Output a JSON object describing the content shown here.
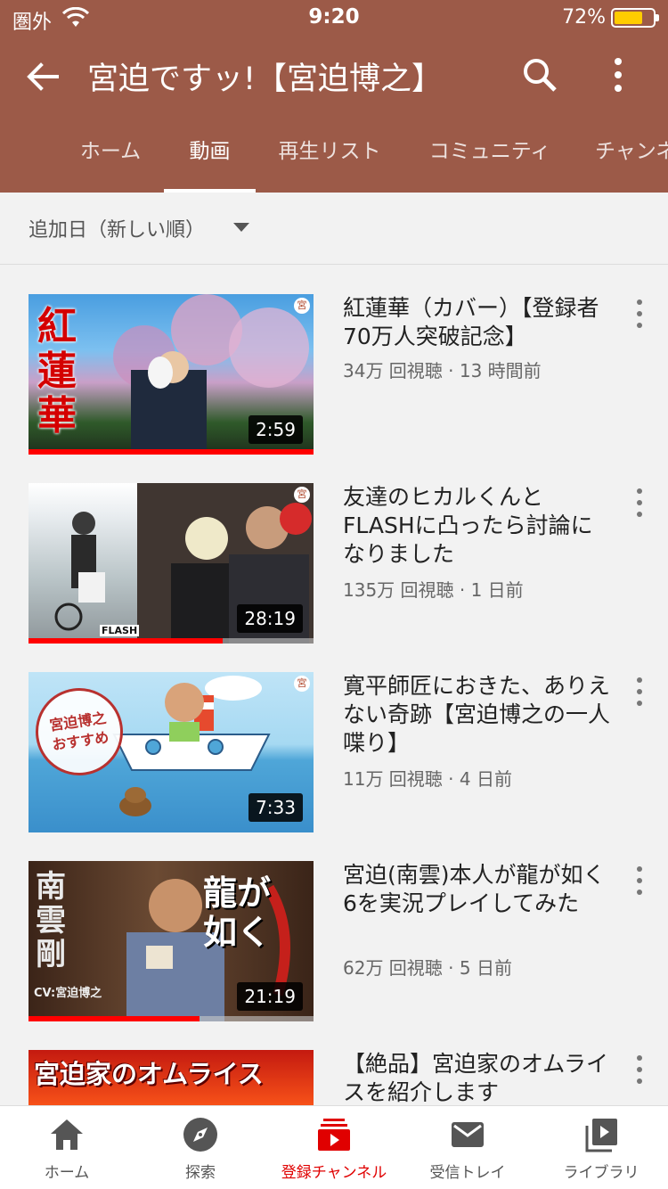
{
  "status_bar": {
    "carrier": "圏外",
    "time": "9:20",
    "battery": "72%"
  },
  "header": {
    "title": "宮迫ですッ!【宮迫博之】"
  },
  "tabs": [
    {
      "label": "ホーム"
    },
    {
      "label": "動画"
    },
    {
      "label": "再生リスト"
    },
    {
      "label": "コミュニティ"
    },
    {
      "label": "チャンネル"
    }
  ],
  "sort": {
    "label": "追加日（新しい順）"
  },
  "videos": [
    {
      "title": "紅蓮華（カバー）【登録者70万人突破記念】",
      "views": "34万 回視聴",
      "age": "13 時間前",
      "meta": "34万 回視聴 · 13 時間前",
      "duration": "2:59",
      "thumb_text": "紅蓮華",
      "progress": 1.0
    },
    {
      "title": "友達のヒカルくんとFLASHに凸ったら討論になりました",
      "views": "135万 回視聴",
      "age": "1 日前",
      "meta": "135万 回視聴 · 1 日前",
      "duration": "28:19",
      "thumb_text": "FLASH",
      "progress": 0.68
    },
    {
      "title": "寛平師匠におきた、ありえない奇跡【宮迫博之の一人喋り】",
      "views": "11万 回視聴",
      "age": "4 日前",
      "meta": "11万 回視聴 · 4 日前",
      "duration": "7:33",
      "thumb_text": "宮迫博之 おすすめ",
      "progress": 0
    },
    {
      "title": "宮迫(南雲)本人が龍が如く6を実況プレイしてみた",
      "views": "62万 回視聴",
      "age": "5 日前",
      "meta": "62万 回視聴 · 5 日前",
      "duration": "21:19",
      "thumb_text_left": "南雲剛",
      "thumb_text_right": "龍が如く",
      "thumb_caption": "CV:宮迫博之",
      "progress": 0.6
    },
    {
      "title": "【絶品】宮迫家のオムライスを紹介します",
      "thumb_text": "宮迫家のオムライス"
    }
  ],
  "bottom_nav": [
    {
      "label": "ホーム",
      "icon": "home-icon"
    },
    {
      "label": "探索",
      "icon": "explore-icon"
    },
    {
      "label": "登録チャンネル",
      "icon": "subscriptions-icon"
    },
    {
      "label": "受信トレイ",
      "icon": "inbox-icon"
    },
    {
      "label": "ライブラリ",
      "icon": "library-icon"
    }
  ],
  "colors": {
    "header_bg": "#9c5a48",
    "accent_red": "#ff0000",
    "nav_active": "#e00000"
  }
}
